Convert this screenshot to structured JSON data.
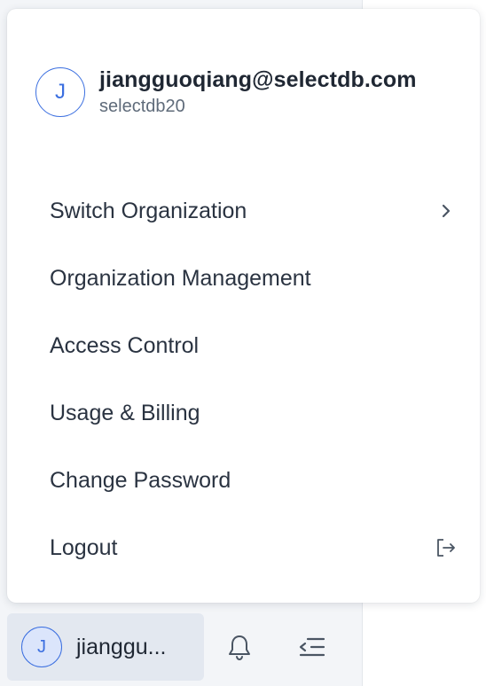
{
  "account": {
    "avatar_initial": "J",
    "email": "jiangguoqiang@selectdb.com",
    "organization": "selectdb20"
  },
  "menu": {
    "items": [
      {
        "label": "Switch Organization",
        "icon": "chevron-right-icon"
      },
      {
        "label": "Organization Management"
      },
      {
        "label": "Access Control"
      },
      {
        "label": "Usage & Billing"
      },
      {
        "label": "Change Password"
      },
      {
        "label": "Logout",
        "icon": "logout-icon"
      }
    ]
  },
  "footer": {
    "avatar_initial": "J",
    "user_label": "jianggu...",
    "icons": [
      "bell-icon",
      "collapse-sidebar-icon"
    ]
  },
  "colors": {
    "accent": "#3b6fe0",
    "text": "#1f2733",
    "muted": "#5f6b7a"
  }
}
